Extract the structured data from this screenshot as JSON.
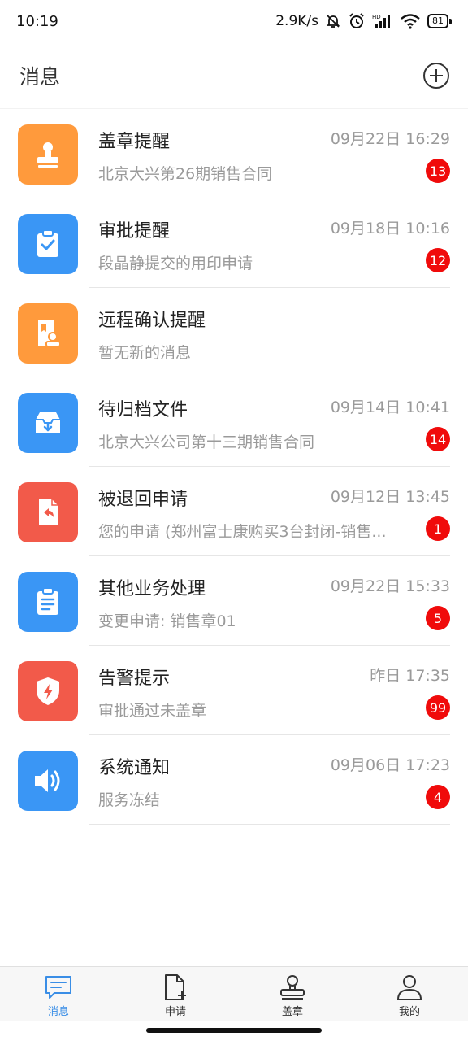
{
  "status_bar": {
    "time": "10:19",
    "net_speed": "2.9K/s",
    "battery": "81",
    "icons": [
      "bell-muted-icon",
      "alarm-icon",
      "signal-icon",
      "wifi-icon",
      "battery-icon"
    ]
  },
  "header": {
    "title": "消息",
    "add_icon": "plus-circle-icon"
  },
  "messages": [
    {
      "title": "盖章提醒",
      "time": "09月22日 16:29",
      "subtitle": "北京大兴第26期销售合同",
      "badge": "13",
      "icon": "stamp-icon",
      "color": "#ff9a3c"
    },
    {
      "title": "审批提醒",
      "time": "09月18日 10:16",
      "subtitle": "段晶静提交的用印申请",
      "badge": "12",
      "icon": "clipboard-check-icon",
      "color": "#3a96f5"
    },
    {
      "title": "远程确认提醒",
      "time": "",
      "subtitle": "暂无新的消息",
      "badge": "",
      "icon": "remote-stamp-icon",
      "color": "#ff9a3c"
    },
    {
      "title": "待归档文件",
      "time": "09月14日 10:41",
      "subtitle": "北京大兴公司第十三期销售合同",
      "badge": "14",
      "icon": "archive-box-icon",
      "color": "#3a96f5"
    },
    {
      "title": "被退回申请",
      "time": "09月12日 13:45",
      "subtitle": "您的申请 (郑州富士康购买3台封闭-销售...",
      "badge": "1",
      "icon": "return-document-icon",
      "color": "#f25a4a"
    },
    {
      "title": "其他业务处理",
      "time": "09月22日 15:33",
      "subtitle": "变更申请: 销售章01",
      "badge": "5",
      "icon": "clipboard-list-icon",
      "color": "#3a96f5"
    },
    {
      "title": "告警提示",
      "time": "昨日 17:35",
      "subtitle": "审批通过未盖章",
      "badge": "99",
      "icon": "shield-alert-icon",
      "color": "#f25a4a"
    },
    {
      "title": "系统通知",
      "time": "09月06日 17:23",
      "subtitle": "服务冻结",
      "badge": "4",
      "icon": "speaker-icon",
      "color": "#3a96f5"
    }
  ],
  "bottom_nav": [
    {
      "label": "消息",
      "icon": "chat-icon",
      "active": true
    },
    {
      "label": "申请",
      "icon": "document-add-icon",
      "active": false
    },
    {
      "label": "盖章",
      "icon": "stamp-outline-icon",
      "active": false
    },
    {
      "label": "我的",
      "icon": "user-icon",
      "active": false
    }
  ],
  "colors": {
    "accent": "#3a8ee6",
    "badge": "#f00b0b"
  }
}
